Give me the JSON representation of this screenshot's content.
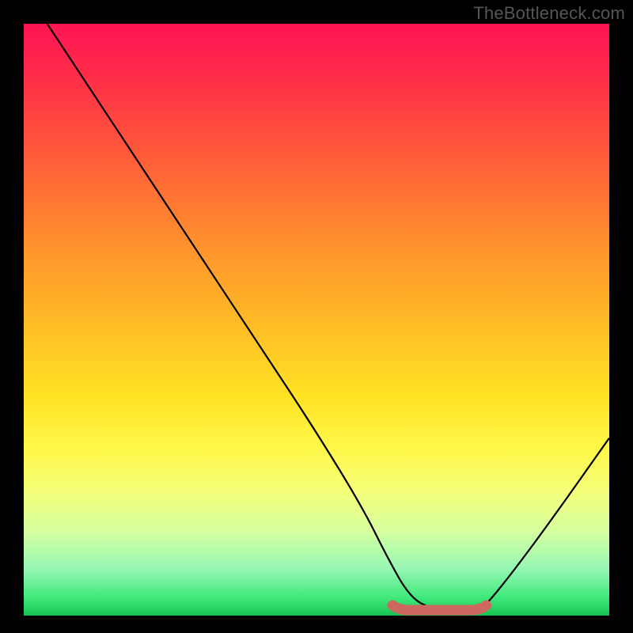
{
  "watermark": "TheBottleneck.com",
  "chart_data": {
    "type": "line",
    "title": "",
    "xlabel": "",
    "ylabel": "",
    "xlim": [
      0,
      100
    ],
    "ylim": [
      0,
      100
    ],
    "series": [
      {
        "name": "bottleneck-curve",
        "x": [
          4,
          10,
          20,
          30,
          40,
          50,
          58,
          62,
          66,
          70,
          74,
          78,
          80,
          84,
          90,
          100
        ],
        "y": [
          100,
          91,
          76,
          61,
          46,
          31,
          18,
          10,
          3,
          1,
          1,
          1,
          3,
          8,
          16,
          30
        ],
        "color": "#000000"
      }
    ],
    "marker": {
      "name": "optimal-zone",
      "x_start": 63,
      "x_end": 79,
      "y": 1.2,
      "color": "#cc6860"
    },
    "gradient_stops": [
      {
        "pos": 0,
        "color": "#ff1454"
      },
      {
        "pos": 8,
        "color": "#ff2a4a"
      },
      {
        "pos": 22,
        "color": "#ff5a3a"
      },
      {
        "pos": 36,
        "color": "#ff8d2e"
      },
      {
        "pos": 50,
        "color": "#ffb926"
      },
      {
        "pos": 63,
        "color": "#ffe324"
      },
      {
        "pos": 72,
        "color": "#fff84a"
      },
      {
        "pos": 79,
        "color": "#f5ff7a"
      },
      {
        "pos": 86,
        "color": "#d4ffa0"
      },
      {
        "pos": 92,
        "color": "#97f7b4"
      },
      {
        "pos": 97,
        "color": "#3fe87a"
      },
      {
        "pos": 100,
        "color": "#18c252"
      }
    ]
  }
}
